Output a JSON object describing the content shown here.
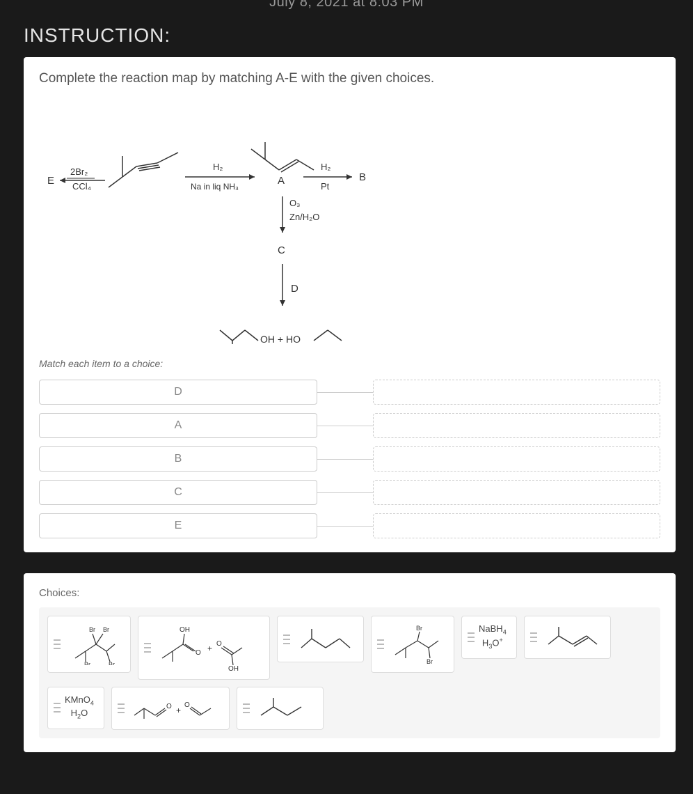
{
  "date": "July 8, 2021 at 8:03 PM",
  "header": "INSTRUCTION:",
  "question": "Complete the reaction map by matching A-E with the given choices.",
  "diagram": {
    "labels": [
      "A",
      "B",
      "C",
      "D",
      "E"
    ],
    "reagents": {
      "left_top": "2Br₂",
      "left_bottom": "CCl₄",
      "mid_top": "H₂",
      "mid_bottom": "Na in liq NH₃",
      "right_top": "H₂",
      "right_bottom": "Pt",
      "down1_top": "O₃",
      "down1_bottom": "Zn/H₂O"
    },
    "products": "OH + HO"
  },
  "match_instruction": "Match each item to a choice:",
  "match_items": [
    "D",
    "A",
    "B",
    "C",
    "E"
  ],
  "choices_label": "Choices:",
  "choices": [
    {
      "id": "tetrabromo",
      "desc": "tetrabromide structure"
    },
    {
      "id": "carboxylic_pair",
      "desc": "OH acid + OH acid"
    },
    {
      "id": "alkane_branched",
      "desc": "branched alkane"
    },
    {
      "id": "dibromo",
      "desc": "Br/Br structure"
    },
    {
      "id": "nabh4",
      "text": "NaBH₄\nH₃O⁺"
    },
    {
      "id": "alkene1",
      "desc": "branched alkene"
    },
    {
      "id": "kmno4",
      "text": "KMnO₄\nH₂O"
    },
    {
      "id": "aldehyde_pair",
      "desc": "O + O aldehydes"
    },
    {
      "id": "alkane2",
      "desc": "isopentane"
    }
  ]
}
